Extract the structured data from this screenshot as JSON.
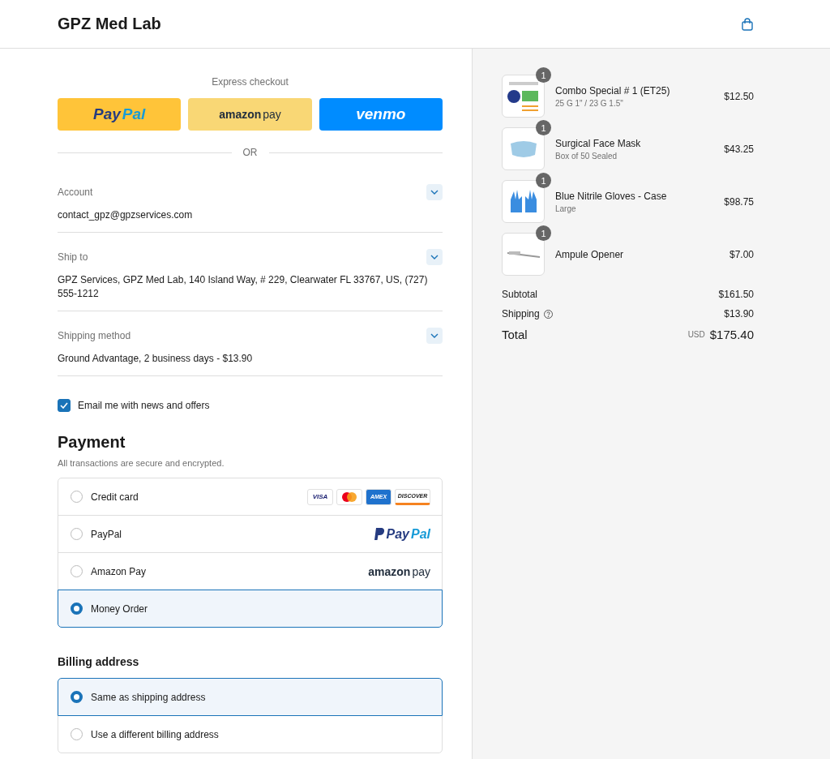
{
  "header": {
    "title": "GPZ Med Lab"
  },
  "express_checkout": {
    "label": "Express checkout",
    "buttons": [
      {
        "kind": "paypal",
        "parts": [
          "Pay",
          "Pal"
        ]
      },
      {
        "kind": "amazon",
        "parts": [
          "amazon",
          "pay"
        ]
      },
      {
        "kind": "venmo",
        "parts": [
          "venmo"
        ]
      }
    ],
    "separator": "OR"
  },
  "summary_sections": [
    {
      "label": "Account",
      "value": "contact_gpz@gpzservices.com"
    },
    {
      "label": "Ship to",
      "value": "GPZ Services, GPZ Med Lab, 140 Island Way, # 229, Clearwater FL 33767, US, (727) 555-1212"
    },
    {
      "label": "Shipping method",
      "value": "Ground Advantage, 2 business days - $13.90"
    }
  ],
  "email_offers": {
    "label": "Email me with news and offers",
    "checked": true
  },
  "payment": {
    "title": "Payment",
    "subtitle": "All transactions are secure and encrypted.",
    "options": [
      {
        "label": "Credit card",
        "selected": false,
        "kind": "cards",
        "cards": [
          {
            "kind": "visa",
            "text": "VISA"
          },
          {
            "kind": "mastercard"
          },
          {
            "kind": "amex",
            "text": "AMEX"
          },
          {
            "kind": "discover",
            "text": "DISCOVER"
          }
        ]
      },
      {
        "label": "PayPal",
        "selected": false,
        "kind": "paypal",
        "parts": [
          "Pay",
          "Pal"
        ]
      },
      {
        "label": "Amazon Pay",
        "selected": false,
        "kind": "amazon",
        "parts": [
          "amazon",
          "pay"
        ]
      },
      {
        "label": "Money Order",
        "selected": true,
        "kind": "plain"
      }
    ]
  },
  "billing": {
    "title": "Billing address",
    "options": [
      {
        "label": "Same as shipping address",
        "selected": true
      },
      {
        "label": "Use a different billing address",
        "selected": false
      }
    ]
  },
  "order": {
    "items": [
      {
        "name": "Combo Special # 1 (ET25)",
        "variant": "25 G 1\" / 23 G 1.5\"",
        "price": "$12.50",
        "quantity": "1",
        "kind": "combo"
      },
      {
        "name": "Surgical Face Mask",
        "variant": "Box of 50 Sealed",
        "price": "$43.25",
        "quantity": "1",
        "kind": "mask"
      },
      {
        "name": "Blue Nitrile Gloves - Case",
        "variant": "Large",
        "price": "$98.75",
        "quantity": "1",
        "kind": "gloves"
      },
      {
        "name": "Ampule Opener",
        "price": "$7.00",
        "quantity": "1",
        "kind": "opener"
      }
    ],
    "subtotal": {
      "label": "Subtotal",
      "value": "$161.50"
    },
    "shipping": {
      "label": "Shipping",
      "value": "$13.90"
    },
    "total": {
      "label": "Total",
      "currency": "USD",
      "value": "$175.40"
    }
  }
}
